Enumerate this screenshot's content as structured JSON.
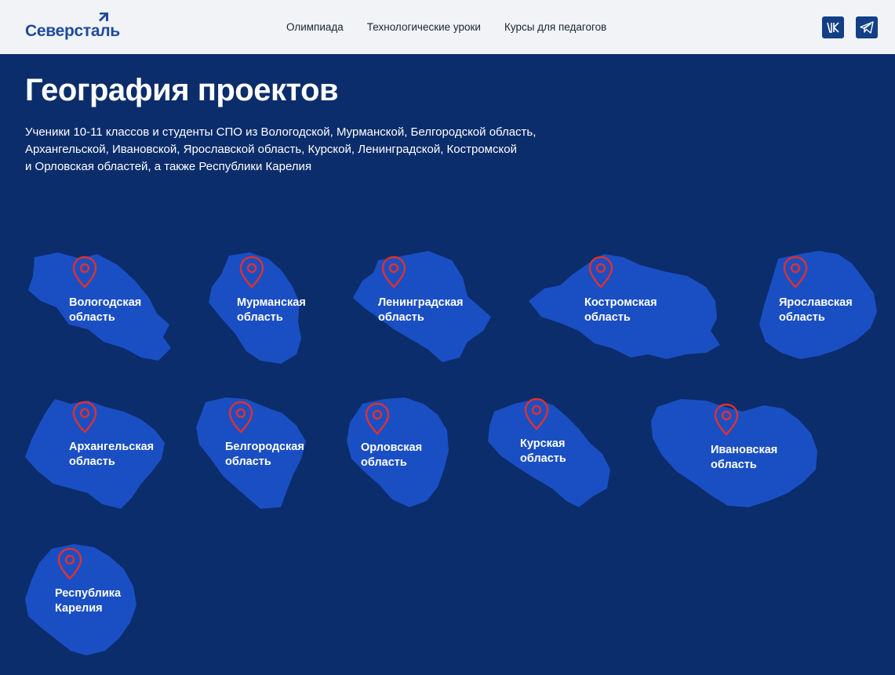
{
  "header": {
    "logo_text": "Северсталь",
    "nav": [
      "Олимпиада",
      "Технологические уроки",
      "Курсы для педагогов"
    ]
  },
  "colors": {
    "background": "#0c2d6b",
    "header_bg": "#f1f3f7",
    "region_fill": "#1a4fc3",
    "pin_color": "#e0302f",
    "brand": "#1f4a9c"
  },
  "page": {
    "title": "География проектов",
    "description_lines": [
      "Ученики 10-11 классов и студенты СПО из Вологодской, Мурманской, Белгородской область,",
      "Архангельской, Ивановской, Ярославской область, Курской, Ленинградской, Костромской",
      "и Орловская областей, а также Республики Карелия"
    ]
  },
  "regions": [
    {
      "line1": "Вологодская",
      "line2": "область"
    },
    {
      "line1": "Мурманская",
      "line2": "область"
    },
    {
      "line1": "Ленинградская",
      "line2": "область"
    },
    {
      "line1": "Костромская",
      "line2": "область"
    },
    {
      "line1": "Ярославская",
      "line2": "область"
    },
    {
      "line1": "Архангельская",
      "line2": "область"
    },
    {
      "line1": "Белгородская",
      "line2": "область"
    },
    {
      "line1": "Орловская",
      "line2": "область"
    },
    {
      "line1": "Курская",
      "line2": "область"
    },
    {
      "line1": "Ивановская",
      "line2": "область"
    },
    {
      "line1": "Республика",
      "line2": "Карелия"
    }
  ]
}
